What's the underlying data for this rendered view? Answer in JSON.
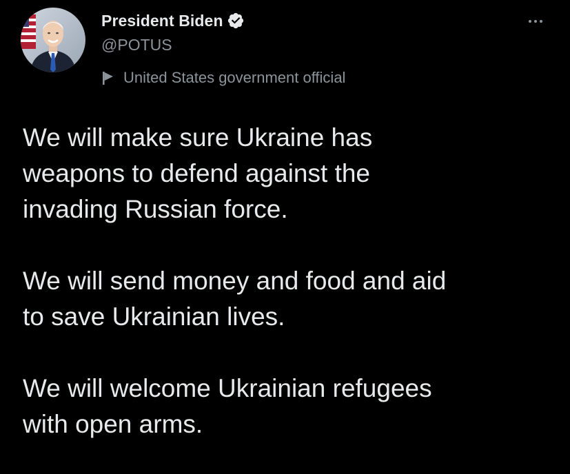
{
  "author": {
    "display_name": "President Biden",
    "handle": "@POTUS",
    "label": "United States government official",
    "verified": true
  },
  "icons": {
    "verified": "verified-badge-icon",
    "label": "flag-icon",
    "more": "more-options-icon"
  },
  "colors": {
    "background": "#000000",
    "text": "#e7e9ea",
    "secondary_text": "#8b949a"
  },
  "tweet": {
    "paragraphs": [
      {
        "lines": [
          "We will make sure Ukraine has",
          "weapons to defend against the",
          "invading Russian force."
        ]
      },
      {
        "lines": [
          "We will send money and food and aid",
          "to save Ukrainian lives."
        ]
      },
      {
        "lines": [
          "We will welcome Ukrainian refugees",
          "with open arms."
        ]
      }
    ]
  }
}
